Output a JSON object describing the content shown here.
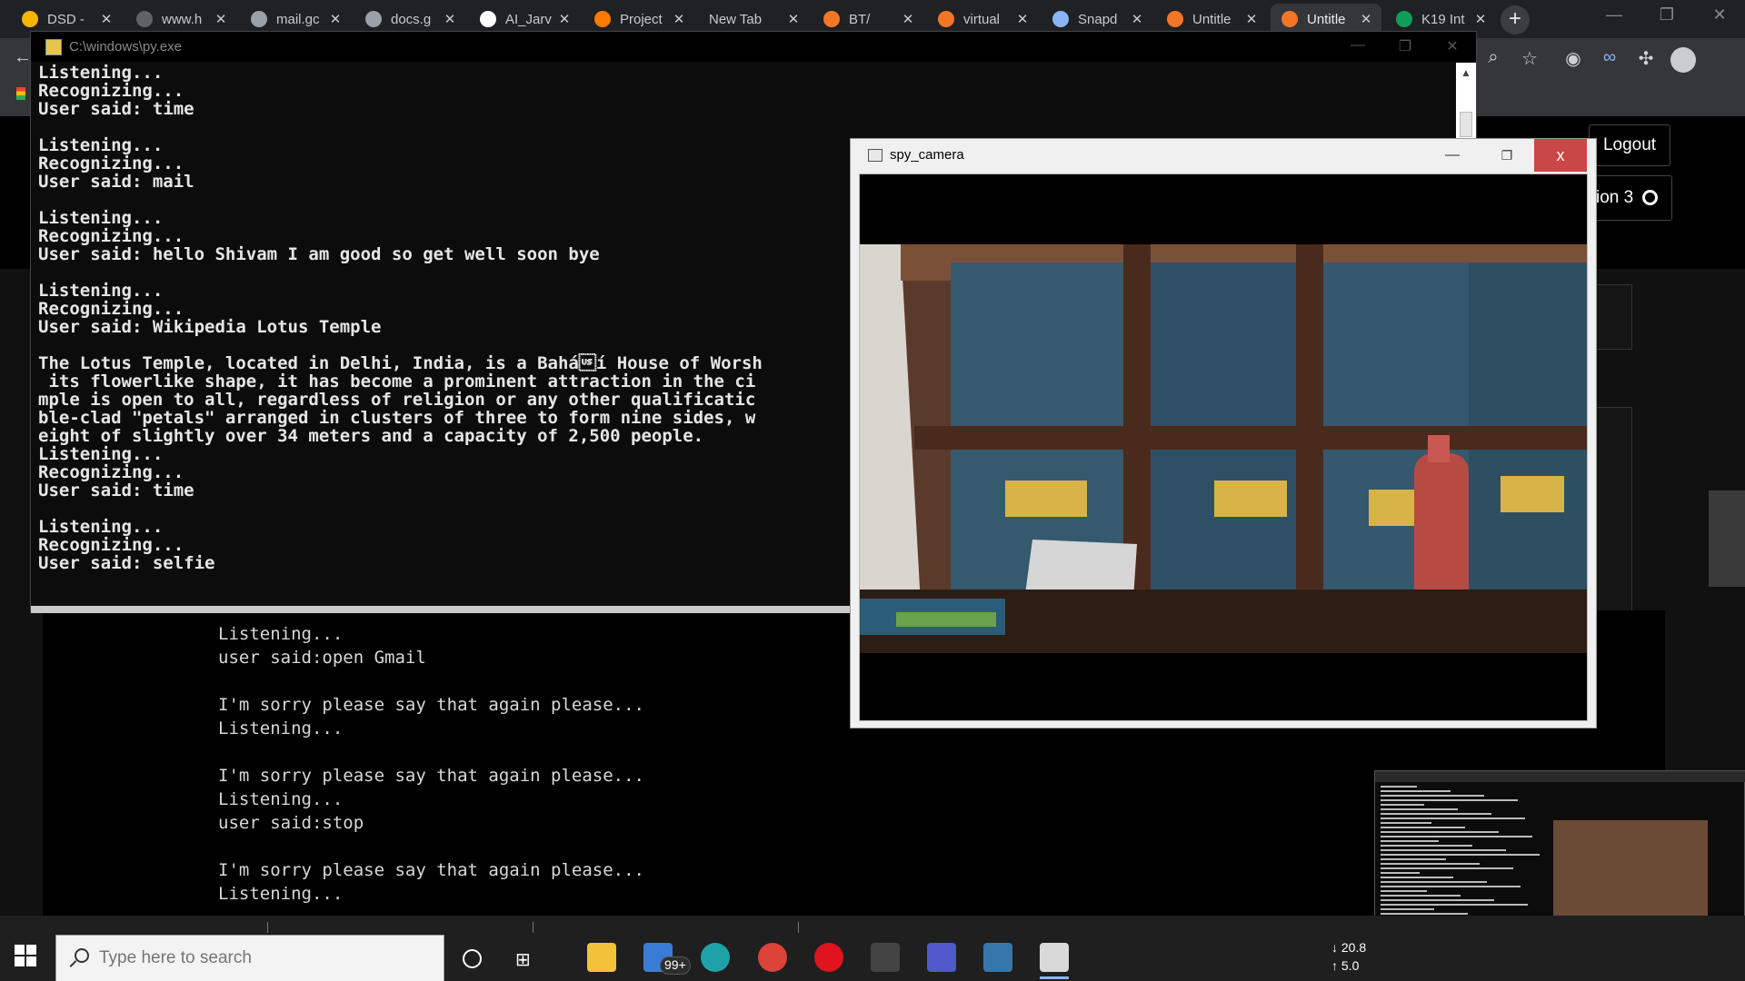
{
  "browser": {
    "tabs": [
      {
        "label": "DSD -",
        "color": "#f4b400"
      },
      {
        "label": "www.h",
        "color": "#5f6368"
      },
      {
        "label": "mail.gc",
        "color": "#9aa0a6"
      },
      {
        "label": "docs.g",
        "color": "#9aa0a6"
      },
      {
        "label": "AI_Jarv",
        "color": "#ffffff"
      },
      {
        "label": "Project",
        "color": "#ff7a00"
      },
      {
        "label": "New Tab",
        "color": ""
      },
      {
        "label": "BT/",
        "color": "#f37626"
      },
      {
        "label": "virtual",
        "color": "#f37626"
      },
      {
        "label": "Snapd",
        "color": "#8ab4f8"
      },
      {
        "label": "Untitle",
        "color": "#f37626"
      },
      {
        "label": "Untitle",
        "color": "#f37626"
      },
      {
        "label": "K19 Int",
        "color": "#0f9d58"
      }
    ],
    "new_tab_symbol": "+",
    "close_symbol": "✕",
    "controls": {
      "minimize": "—",
      "maximize": "❐",
      "close": "✕"
    }
  },
  "webpage": {
    "logout_label": "Logout",
    "session_label": "ion 3"
  },
  "console": {
    "title": "C:\\windows\\py.exe",
    "lines": [
      "Listening...",
      "Recognizing...",
      "User said: time",
      "",
      "Listening...",
      "Recognizing...",
      "User said: mail",
      "",
      "Listening...",
      "Recognizing...",
      "User said: hello Shivam I am good so get well soon bye",
      "",
      "Listening...",
      "Recognizing...",
      "User said: Wikipedia Lotus Temple",
      "",
      "The Lotus Temple, located in Delhi, India, is a Bahá\u001fí House of Worsh",
      " its flowerlike shape, it has become a prominent attraction in the ci",
      "mple is open to all, regardless of religion or any other qualificatic",
      "ble-clad \"petals\" arranged in clusters of three to form nine sides, w",
      "eight of slightly over 34 meters and a capacity of 2,500 people.",
      "Listening...",
      "Recognizing...",
      "User said: time",
      "",
      "Listening...",
      "Recognizing...",
      "User said: selfie"
    ]
  },
  "lower_console": {
    "lines": [
      "Listening...",
      "user said:open Gmail",
      "",
      "I'm sorry please say that again please...",
      "Listening...",
      "",
      "I'm sorry please say that again please...",
      "Listening...",
      "user said:stop",
      "",
      "I'm sorry please say that again please...",
      "Listening..."
    ]
  },
  "camera": {
    "title": "spy_camera",
    "close_symbol": "x"
  },
  "taskbar": {
    "search_placeholder": "Type here to search",
    "mail_badge": "99+",
    "net_down": "20.8",
    "net_up": "5.0",
    "apps": [
      {
        "name": "file-explorer",
        "color": "#f3c13a"
      },
      {
        "name": "mail",
        "color": "#3a7bd5"
      },
      {
        "name": "edge",
        "color": "#1fa1a8"
      },
      {
        "name": "chrome",
        "color": "#db4437"
      },
      {
        "name": "opera",
        "color": "#e0141e"
      },
      {
        "name": "terminal",
        "color": "#444444"
      },
      {
        "name": "teams",
        "color": "#5059c9"
      },
      {
        "name": "python",
        "color": "#3776ab"
      },
      {
        "name": "ipython",
        "color": "#d9d9d9"
      }
    ]
  }
}
